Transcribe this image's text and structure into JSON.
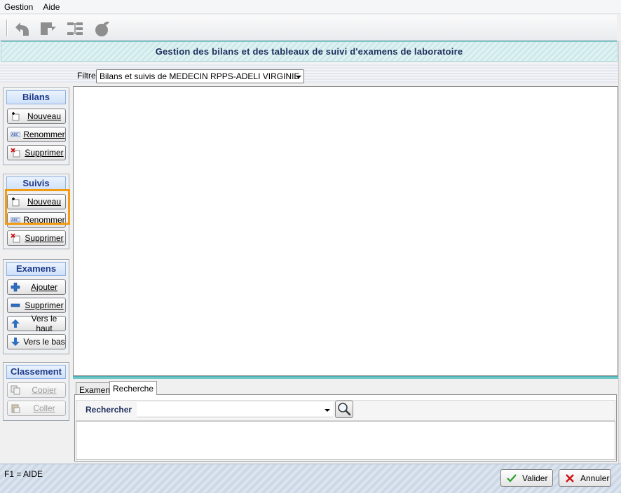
{
  "menu": {
    "items": [
      "Gestion",
      "Aide"
    ]
  },
  "toolbar": {
    "icons": [
      "back-icon",
      "export-icon",
      "tree-icon",
      "apple-icon"
    ]
  },
  "header": {
    "title": "Gestion des bilans et des tableaux de suivi d'examens de laboratoire"
  },
  "filter": {
    "label": "Filtre",
    "value": "Bilans et suivis de MEDECIN RPPS-ADELI VIRGINIE"
  },
  "bilans": {
    "title": "Bilans",
    "new": "Nouveau",
    "rename": "Renommer",
    "delete": "Supprimer"
  },
  "suivis": {
    "title": "Suivis",
    "new": "Nouveau",
    "rename": "Renommer",
    "delete": "Supprimer"
  },
  "examens": {
    "title": "Examens",
    "add": "Ajouter",
    "delete": "Supprimer",
    "up": "Vers le haut",
    "down": "Vers le bas"
  },
  "classement": {
    "title": "Classement",
    "copy": "Copier",
    "paste": "Coller"
  },
  "tabs": {
    "examen": "Examen",
    "recherche": "Recherche"
  },
  "search": {
    "label": "Rechercher",
    "value": ""
  },
  "footer": {
    "help": "F1 = AIDE",
    "validate": "Valider",
    "cancel": "Annuler"
  },
  "colors": {
    "accent": "#1f3a8a",
    "highlight": "#f39c12",
    "teal": "#6ec7c9"
  }
}
